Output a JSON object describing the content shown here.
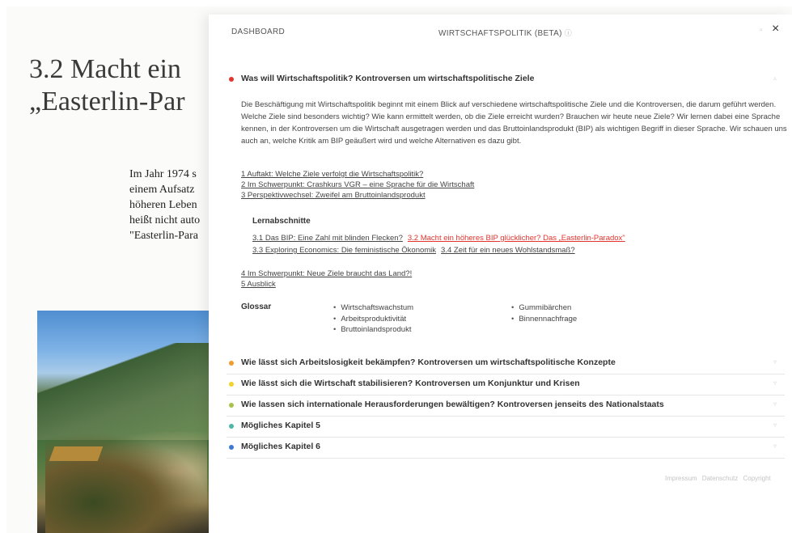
{
  "article": {
    "title_line1": "3.2 Macht ein",
    "title_line2": "„Easterlin-Par",
    "body_lines": [
      "Im Jahr 1974 s",
      "einem Aufsatz",
      "höheren Leben",
      "heißt nicht auto",
      "\"Easterlin-Para"
    ]
  },
  "panel": {
    "dashboard_label": "DASHBOARD",
    "title": "WIRTSCHAFTSPOLITIK (BETA)",
    "title_info": "ⓘ",
    "close_label": "×"
  },
  "chapters": [
    {
      "label": "Was will Wirtschaftspolitik? Kontroversen um wirtschaftspolitische Ziele",
      "color": "#e3342f"
    },
    {
      "label": "Wie lässt sich Arbeitslosigkeit bekämpfen? Kontroversen um wirtschaftspolitische Konzepte",
      "color": "#f29b2b"
    },
    {
      "label": "Wie lässt sich die Wirtschaft stabilisieren? Kontroversen um Konjunktur und Krisen",
      "color": "#f2d32b"
    },
    {
      "label": "Wie lassen sich internationale Herausforderungen bewältigen? Kontroversen jenseits des Nationalstaats",
      "color": "#a8c24a"
    },
    {
      "label": "Mögliches Kapitel 5",
      "color": "#4bb7a8"
    },
    {
      "label": "Mögliches Kapitel 6",
      "color": "#3b78d8"
    }
  ],
  "intro": "Die Beschäftigung mit Wirtschaftspolitik beginnt mit einem Blick auf verschiedene wirtschaftspolitische Ziele und die Kontroversen, die darum geführt werden. Welche Ziele sind besonders wichtig? Wie kann ermittelt werden, ob die Ziele erreicht wurden? Brauchen wir heute neue Ziele? Wir lernen dabei eine Sprache kennen, in der Kontroversen um die Wirtschaft ausgetragen werden und das Bruttoinlandsprodukt (BIP) als wichtigen Begriff in dieser Sprache. Wir schauen uns auch an, welche Kritik am BIP geäußert wird und welche Alternativen es dazu gibt.",
  "toc": {
    "items_top": [
      "1 Auftakt: Welche Ziele verfolgt die Wirtschaftspolitik?",
      "2 Im Schwerpunkt: Crashkurs VGR – eine Sprache für die Wirtschaft",
      "3 Perspektivwechsel: Zweifel am Bruttoinlandsprodukt"
    ],
    "lern_heading": "Lernabschnitte",
    "lern_row1": [
      "3.1 Das BIP: Eine Zahl mit blinden Flecken?"
    ],
    "lern_active": "3.2 Macht ein höheres BIP glücklicher? Das „Easterlin-Paradox\"",
    "lern_row2": [
      "3.3 Exploring Economics: Die feministische Ökonomik",
      "3.4 Zeit für ein neues Wohlstandsmaß?"
    ],
    "items_bottom": [
      "4 Im Schwerpunkt: Neue Ziele braucht das Land?!",
      "5 Ausblick"
    ]
  },
  "glossar": {
    "heading": "Glossar",
    "col1": [
      "Wirtschaftswachstum",
      "Arbeitsproduktivität",
      "Bruttoinlandsprodukt"
    ],
    "col2": [
      "Gummibärchen",
      "Binnennachfrage"
    ]
  },
  "footer": {
    "links": [
      "Impressum",
      "Datenschutz",
      "Copyright"
    ]
  },
  "icons": {
    "chevron": "triangle-icon",
    "close": "close-icon"
  }
}
